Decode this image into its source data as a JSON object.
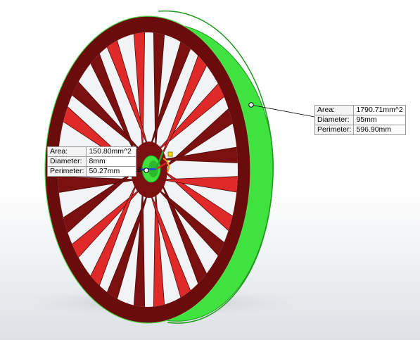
{
  "colors": {
    "spoke": "#7a1010",
    "spoke_light": "#e02a2a",
    "rim_face": "#6e0d0d",
    "selection": "#33dd33",
    "selection_dark": "#1c9a1c",
    "background_top": "#ffffff",
    "background_bottom": "#dde1e5"
  },
  "callouts": {
    "hub": {
      "area_label": "Area:",
      "area_value": "150.80mm^2",
      "diameter_label": "Diameter:",
      "diameter_value": "8mm",
      "perimeter_label": "Perimeter:",
      "perimeter_value": "50.27mm"
    },
    "rim": {
      "area_label": "Area:",
      "area_value": "1790.71mm^2",
      "diameter_label": "Diameter:",
      "diameter_value": "95mm",
      "perimeter_label": "Perimeter:",
      "perimeter_value": "596.90mm"
    }
  },
  "triad": {
    "z_label": "Z"
  },
  "icons": {
    "triad": "coordinate-triad-icon",
    "selection_point": "selection-point-icon"
  }
}
